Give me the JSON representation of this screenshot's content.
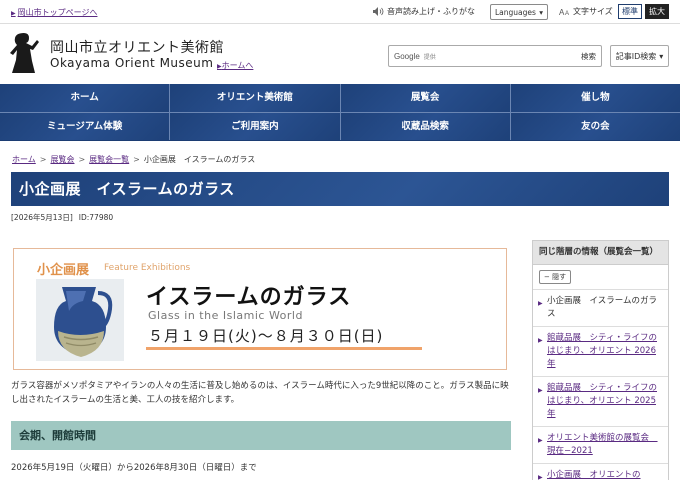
{
  "topbar": {
    "top_link": "岡山市トップページへ",
    "voice": "音声読み上げ・ふりがな",
    "languages": "Languages",
    "font_size_label": "文字サイズ",
    "font_standard": "標準",
    "font_large": "拡大"
  },
  "header": {
    "title_ja": "岡山市立オリエント美術館",
    "title_en": "Okayama Orient Museum",
    "home_link": "ホームへ",
    "search_brand": "Google",
    "search_placeholder": "提供",
    "search_button": "検索",
    "id_search": "記事ID検索"
  },
  "nav": {
    "row1": [
      "ホーム",
      "オリエント美術館",
      "展覧会",
      "催し物"
    ],
    "row2": [
      "ミュージアム体験",
      "ご利用案内",
      "収蔵品検索",
      "友の会"
    ]
  },
  "breadcrumb": [
    "ホーム",
    "展覧会",
    "展覧会一覧",
    "小企画展　イスラームのガラス"
  ],
  "page": {
    "title": "小企画展　イスラームのガラス",
    "date": "[2026年5月13日]",
    "id": "ID:77980"
  },
  "banner": {
    "tag": "小企画展",
    "tag_en": "Feature Exhibitions",
    "title": "イスラームのガラス",
    "subtitle": "Glass in the Islamic World",
    "dates": "５月１９日(火)～８月３０日(日)"
  },
  "content": {
    "description": "ガラス容器がメソポタミアやイランの人々の生活に普及し始めるのは、イスラーム時代に入った9世紀以降のこと。ガラス製品に映し出されたイスラームの生活と美、工人の技を紹介します。",
    "section_heading": "会期、開館時間",
    "period": "2026年5月19日（火曜日）から2026年8月30日（日曜日）まで"
  },
  "sidebar": {
    "heading": "同じ階層の情報（展覧会一覧）",
    "toggle": "隠す",
    "items": [
      "小企画展　イスラームのガラス",
      "館蔵品展　シティ・ライフのはじまり、オリエント 2026年",
      "館蔵品展　シティ・ライフのはじまり、オリエント 2025年",
      "オリエント美術館の展覧会　現在−2021",
      "小企画展　オリエントの"
    ]
  },
  "colors": {
    "nav_bg": "#1c3d73",
    "link": "#5a2a82",
    "section_bg": "#9fc7c1",
    "banner_accent": "#f0a36a"
  }
}
